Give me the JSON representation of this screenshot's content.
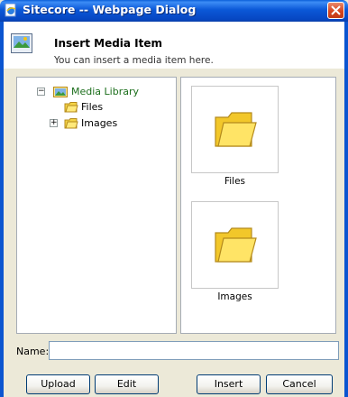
{
  "window": {
    "title": "Sitecore -- Webpage Dialog",
    "app_icon": "ie-page-icon",
    "close_icon": "close-icon"
  },
  "header": {
    "title": "Insert Media Item",
    "subtitle": "You can insert a media item here.",
    "icon": "media-image-icon"
  },
  "tree": {
    "root": {
      "label": "Media Library",
      "expander": "⊟",
      "icon": "media-library-icon",
      "selected": true
    },
    "children": [
      {
        "label": "Files",
        "expander": "",
        "icon": "folder-icon"
      },
      {
        "label": "Images",
        "expander": "⊞",
        "icon": "folder-icon"
      }
    ]
  },
  "media": {
    "items": [
      {
        "label": "Files",
        "icon": "folder-icon"
      },
      {
        "label": "Images",
        "icon": "folder-icon"
      }
    ]
  },
  "name_field": {
    "label": "Name:",
    "value": "",
    "placeholder": ""
  },
  "buttons": {
    "upload": "Upload",
    "edit": "Edit",
    "insert": "Insert",
    "cancel": "Cancel"
  },
  "colors": {
    "titlebar": "#0b58d7",
    "dialog_bg": "#ece9d8",
    "selected_node": "#1b6e1b",
    "close_button": "#d6451f"
  }
}
